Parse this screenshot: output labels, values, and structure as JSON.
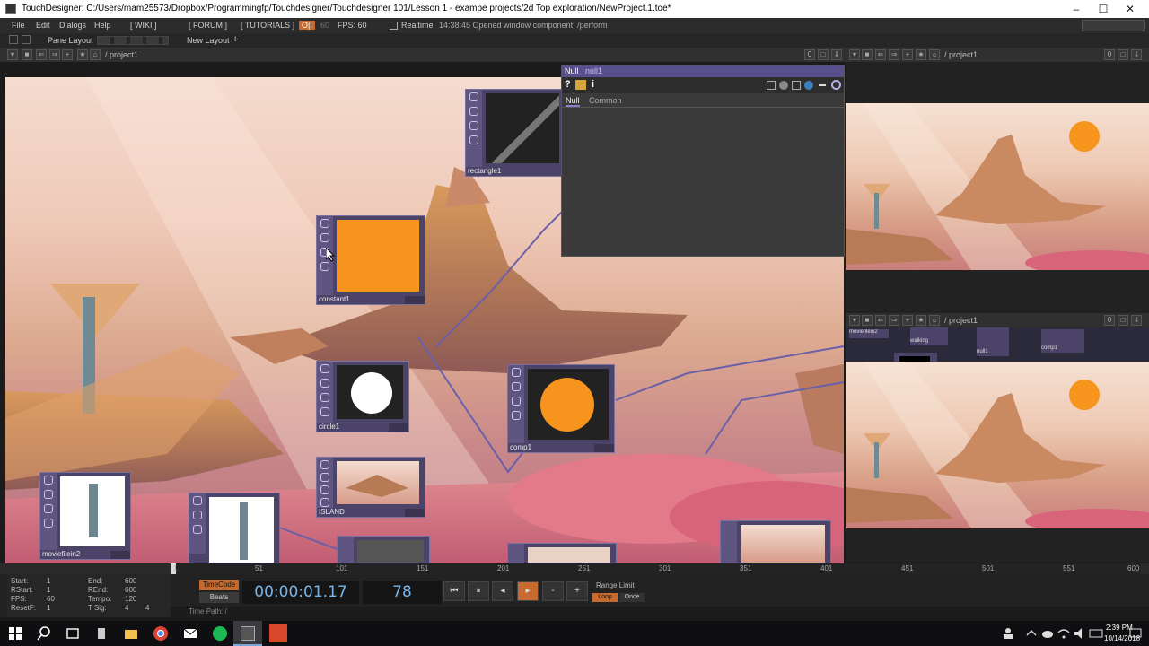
{
  "window": {
    "title": "TouchDesigner: C:/Users/mam25573/Dropbox/Programmingfp/Touchdesigner/Touchdesigner 101/Lesson 1 - exampe projects/2d Top exploration/NewProject.1.toe*",
    "minimize": "–",
    "maximize": "☐",
    "close": "✕"
  },
  "menu": {
    "file": "File",
    "edit": "Edit",
    "dialogs": "Dialogs",
    "help": "Help",
    "wiki": "[ WIKI ]",
    "forum": "[ FORUM ]",
    "tutorials": "[ TUTORIALS ]",
    "oi": "O|I",
    "sixty": "60",
    "fps": "FPS: 60",
    "realtime": "Realtime",
    "status": "14:38:45 Opened window component: /perform"
  },
  "layoutbar": {
    "pane_layout": "Pane Layout",
    "new_layout": "New Layout",
    "plus": "+"
  },
  "network_pane": {
    "path": "/ project1",
    "counter": "0"
  },
  "nodes": {
    "rectangle": "rectangle1",
    "constant": "constant1",
    "circle": "circle1",
    "comp": "comp1",
    "island": "ISLAND",
    "movie": "moviefilein2"
  },
  "param": {
    "type": "Null",
    "name": "null1",
    "help": "?",
    "info": "i",
    "tab_null": "Null",
    "tab_common": "Common"
  },
  "right_top": {
    "path": "/ project1",
    "counter": "0"
  },
  "right_bottom": {
    "path": "/ project1",
    "counter": "0",
    "mini_nodes": [
      "moviefilein2",
      "walking",
      "null1",
      "comp1"
    ]
  },
  "timeline": {
    "ticks": [
      "1",
      "51",
      "101",
      "151",
      "201",
      "251",
      "301",
      "351",
      "401",
      "451",
      "501",
      "551",
      "600"
    ]
  },
  "range": {
    "start_label": "Start:",
    "start": "1",
    "end_label": "End:",
    "end": "600",
    "rstart_label": "RStart:",
    "rstart": "1",
    "rend_label": "REnd:",
    "rend": "600",
    "fps_label": "FPS:",
    "fps": "60",
    "tempo_label": "Tempo:",
    "tempo": "120",
    "resetf_label": "ResetF:",
    "resetf": "1",
    "tsig_label": "T Sig:",
    "tsig_a": "4",
    "tsig_b": "4"
  },
  "transport": {
    "timecode_label": "TimeCode",
    "beats_label": "Beats",
    "timecode": "00:00:01.17",
    "frame": "78",
    "range_limit": "Range Limit",
    "loop": "Loop",
    "once": "Once",
    "time_path": "Time Path: /"
  },
  "taskbar": {
    "time": "2:39 PM",
    "date": "10/14/2018"
  }
}
